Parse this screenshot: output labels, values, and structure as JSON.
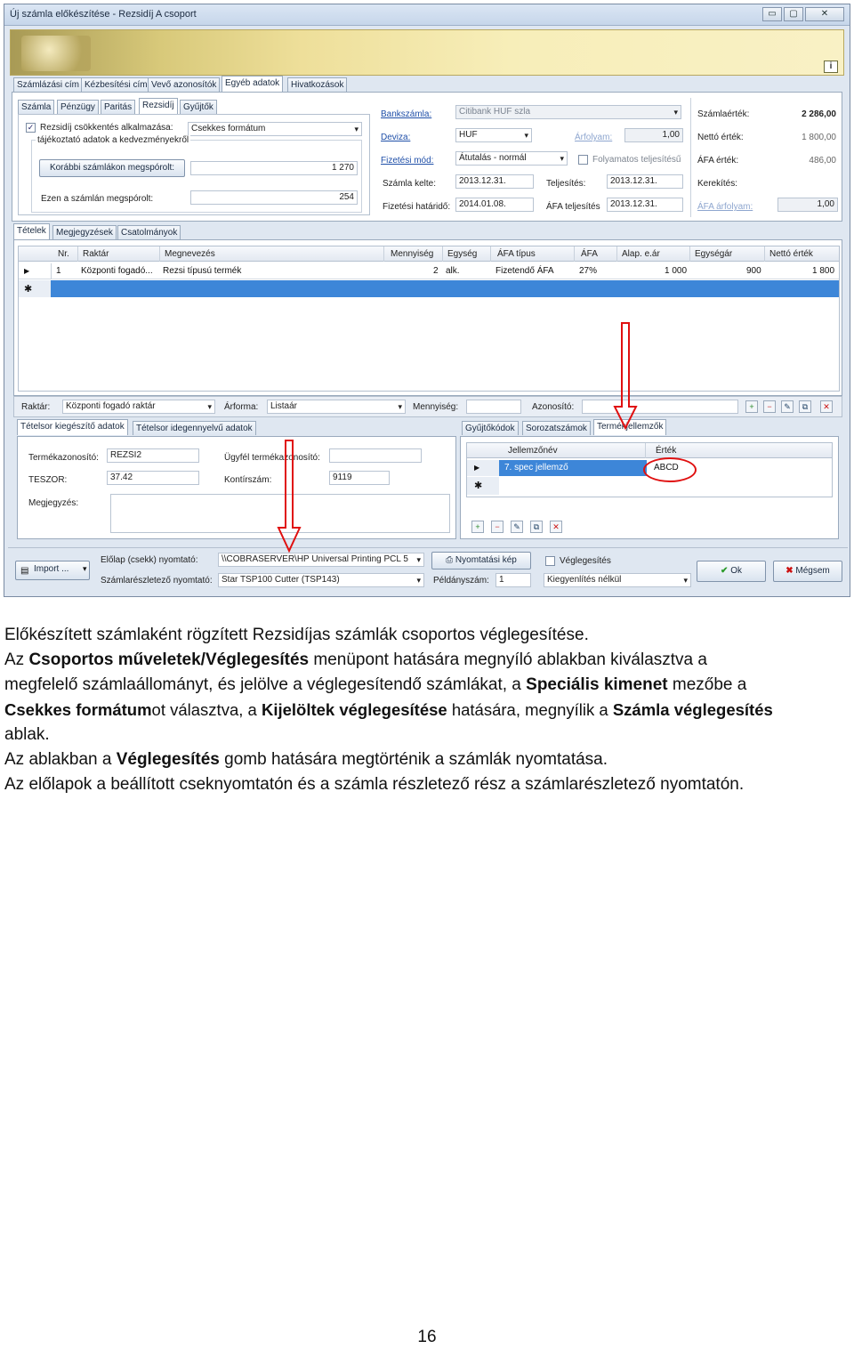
{
  "window": {
    "title": "Új számla előkészítése - Rezsidíj A csoport",
    "info_label": "i"
  },
  "top_tabs": [
    "Számlázási cím",
    "Kézbesítési cím",
    "Vevő azonosítók",
    "Egyéb adatok",
    "Hivatkozások"
  ],
  "sub_tabs": [
    "Számla",
    "Pénzügy",
    "Paritás",
    "Rezsidíj",
    "Gyűjtők"
  ],
  "rezsidij": {
    "checkbox_label": "Rezsidíj csökkentés alkalmazása:",
    "checkbox_checked": "✓",
    "format_value": "Csekkes formátum",
    "info_header": "tájékoztató adatok a kedvezményekről",
    "prev_button": "Korábbi számlákon megspórolt:",
    "prev_value": "1 270",
    "this_label": "Ezen a számlán megspórolt:",
    "this_value": "254"
  },
  "payment": {
    "bank_label": "Bankszámla:",
    "bank_value": "Citibank HUF szla",
    "currency_label": "Deviza:",
    "currency_value": "HUF",
    "rate_label": "Árfolyam:",
    "rate_value": "1,00",
    "method_label": "Fizetési mód:",
    "method_value": "Átutalás - normál",
    "continuous_label": "Folyamatos teljesítésű",
    "issue_label": "Számla kelte:",
    "issue_value": "2013.12.31.",
    "perf_label": "Teljesítés:",
    "perf_value": "2013.12.31.",
    "due_label": "Fizetési határidő:",
    "due_value": "2014.01.08.",
    "vat_perf_label": "ÁFA teljesítés",
    "vat_perf_value": "2013.12.31."
  },
  "totals": {
    "invoice_label": "Számlaérték:",
    "invoice_value": "2 286,00",
    "net_label": "Nettó érték:",
    "net_value": "1 800,00",
    "vat_label": "ÁFA érték:",
    "vat_value": "486,00",
    "rounding_label": "Kerekítés:",
    "vat_rate_label": "ÁFA árfolyam:",
    "vat_rate_value": "1,00"
  },
  "item_tabs": [
    "Tételek",
    "Megjegyzések",
    "Csatolmányok"
  ],
  "items_grid": {
    "headers": [
      "Nr.",
      "Raktár",
      "Megnevezés",
      "Mennyiség",
      "Egység",
      "ÁFA típus",
      "ÁFA",
      "Alap. e.ár",
      "Egységár",
      "Nettó érték"
    ],
    "row": [
      "1",
      "Központi fogadó...",
      "Rezsi típusú termék",
      "2",
      "alk.",
      "Fizetendő ÁFA",
      "27%",
      "1 000",
      "900",
      "1 800"
    ],
    "new_row_marker": "✱",
    "current_row_marker": "▶"
  },
  "filter_bar": {
    "warehouse_label": "Raktár:",
    "warehouse_value": "Központi fogadó raktár",
    "pricing_label": "Árforma:",
    "pricing_value": "Listaár",
    "qty_label": "Mennyiség:",
    "id_label": "Azonosító:"
  },
  "detail_tabs": [
    "Tételsor kiegészítő adatok",
    "Tételsor idegennyelvű adatok"
  ],
  "detail": {
    "product_id_label": "Termékazonosító:",
    "product_id_value": "REZSI2",
    "customer_id_label": "Ügyfél termékazonosító:",
    "teszor_label": "TESZOR:",
    "teszor_value": "37.42",
    "account_label": "Kontírszám:",
    "account_value": "9119",
    "note_label": "Megjegyzés:"
  },
  "feature_tabs": [
    "Gyűjtőkódok",
    "Sorozatszámok",
    "Termékjellemzők"
  ],
  "features_grid": {
    "headers": [
      "Jellemzőnév",
      "Érték"
    ],
    "row": [
      "7. spec jellemző",
      "ABCD"
    ]
  },
  "footer": {
    "import_label": "Import ...",
    "front_printer_label": "Előlap (csekk) nyomtató:",
    "front_printer_value": "\\\\COBRASERVER\\HP Universal Printing PCL 5",
    "detail_printer_label": "Számlarészletező nyomtató:",
    "detail_printer_value": "Star TSP100 Cutter (TSP143)",
    "print_image_label": "Nyomtatási kép",
    "copies_label": "Példányszám:",
    "copies_value": "1",
    "finalize_label": "Véglegesítés",
    "finalize_mode_value": "Kiegyenlítés nélkül",
    "ok_label": "Ok",
    "cancel_label": "Mégsem"
  },
  "text": {
    "line1": "Előkészített számlaként rögzített Rezsidíjas számlák csoportos véglegesítése.",
    "line2_a": "Az ",
    "line2_b": "Csoportos műveletek/Véglegesítés",
    "line2_c": " menüpont hatására megnyíló ablakban kiválasztva a",
    "line3_a": "megfelelő számlaállományt, és jelölve a véglegesítendő számlákat, a ",
    "line3_b": "Speciális kimenet",
    "line3_c": " mezőbe a",
    "line4_a": "Csekkes formátum",
    "line4_b": "ot választva, a ",
    "line4_c": "Kijelöltek véglegesítése",
    "line4_d": " hatására, megnyílik a ",
    "line4_e": "Számla véglegesítés",
    "line5": "ablak.",
    "line6_a": "Az ablakban a ",
    "line6_b": "Véglegesítés",
    "line6_c": " gomb hatására megtörténik a számlák nyomtatása.",
    "line7": "Az előlapok a beállított cseknyomtatón és a számla részletező rész a számlarészletező nyomtatón.",
    "page_number": "16"
  },
  "colors": {
    "selection": "#3d86d8",
    "annotation": "#e01010"
  }
}
